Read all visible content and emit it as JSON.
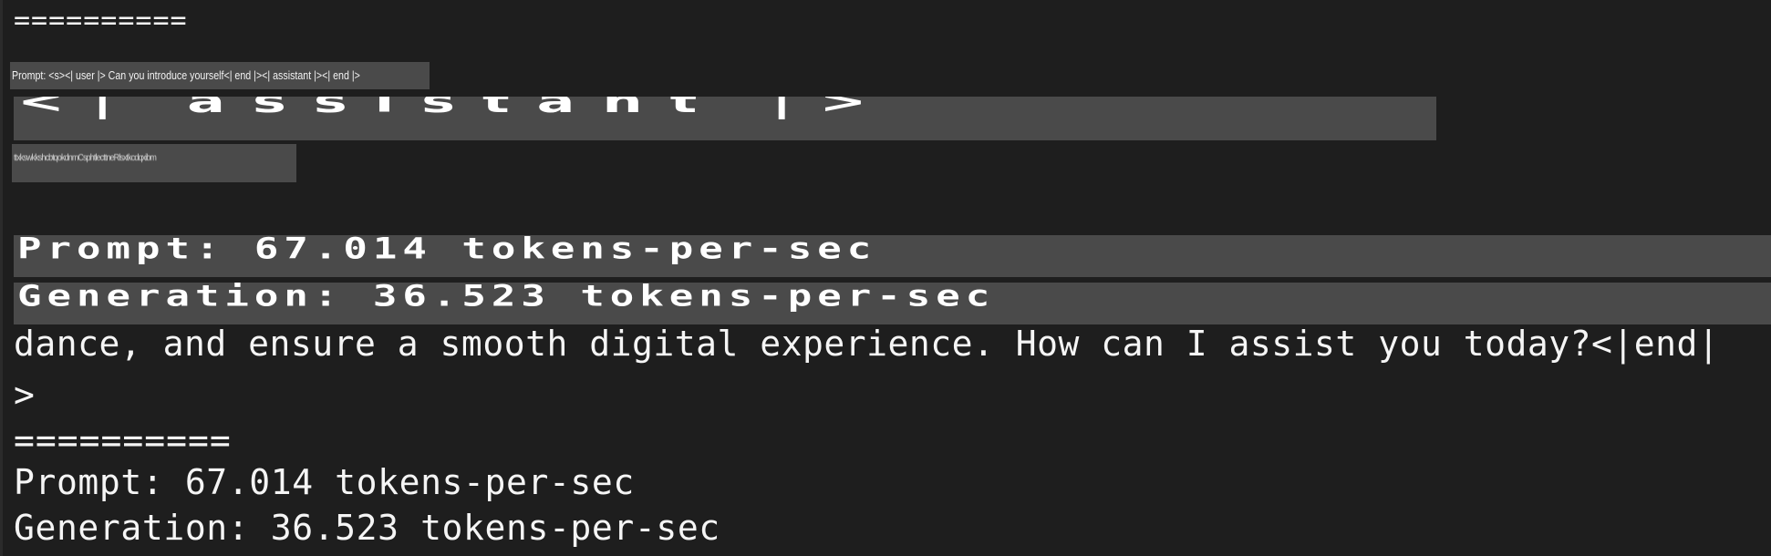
{
  "terminal": {
    "separator_top": "==========",
    "prompt_line": "Prompt: <s><| user |> Can you introduce yourself<| end |><| assistant |><| end |>",
    "assistant_tag": "<| assistant |>",
    "garbled_line": "ttxkswkkshcbtqokdnmCsphtlecttneRlsxtkcdqxibm",
    "stretched_prompt_stat": "Prompt: 67.014 tokens-per-sec",
    "stretched_generation_stat": "Generation: 36.523 tokens-per-sec",
    "response_line_1": "dance, and ensure a smooth digital experience. How can I assist you today?<|end|",
    "response_line_2": ">",
    "separator_bottom": "==========",
    "prompt_stat": "Prompt: 67.014 tokens-per-sec",
    "generation_stat": "Generation: 36.523 tokens-per-sec"
  },
  "colors": {
    "background": "#1e1e1e",
    "highlight": "#4a4a4a",
    "text": "#f5f5f5"
  }
}
